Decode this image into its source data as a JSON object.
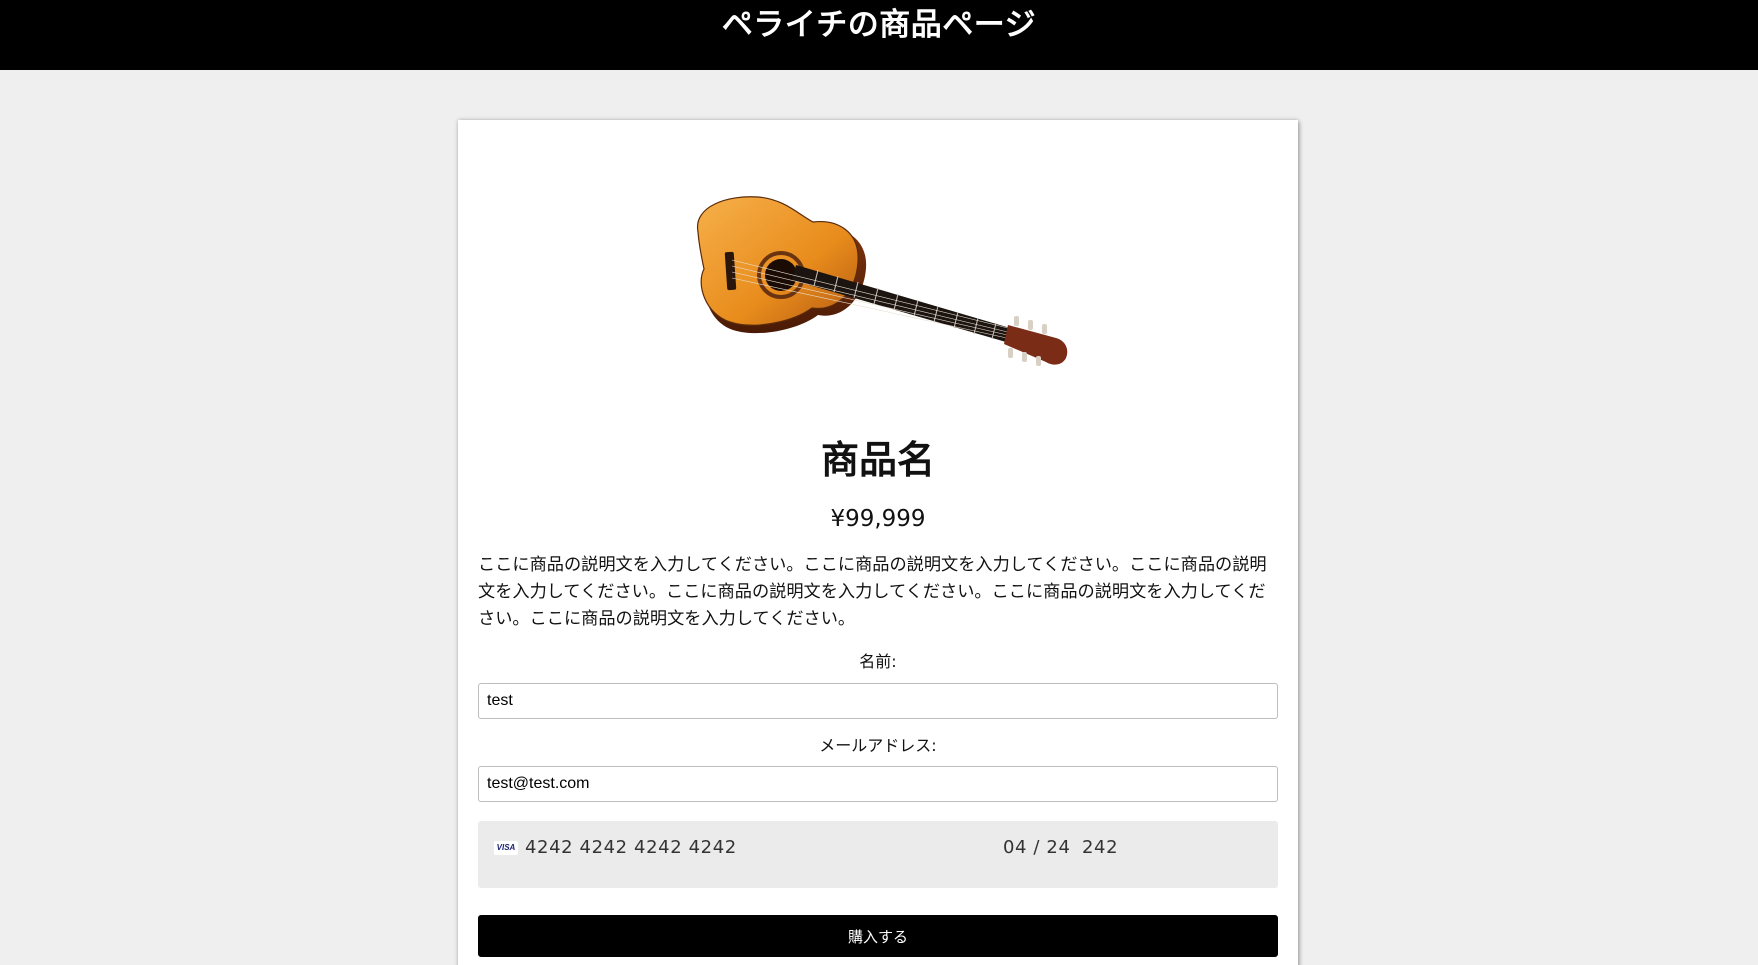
{
  "header": {
    "title": "ペライチの商品ページ"
  },
  "product": {
    "image": "acoustic-guitar",
    "name": "商品名",
    "price": "¥99,999",
    "description": "ここに商品の説明文を入力してください。ここに商品の説明文を入力してください。ここに商品の説明文を入力してください。ここに商品の説明文を入力してください。ここに商品の説明文を入力してください。ここに商品の説明文を入力してください。"
  },
  "form": {
    "name_label": "名前:",
    "name_value": "test",
    "email_label": "メールアドレス:",
    "email_value": "test@test.com",
    "card": {
      "brand": "VISA",
      "number": "4242 4242 4242 4242",
      "expiry": "04 / 24",
      "cvc": "242"
    },
    "submit_label": "購入する"
  },
  "colors": {
    "header_bg": "#000000",
    "button_bg": "#000000",
    "page_bg": "#efefef"
  }
}
